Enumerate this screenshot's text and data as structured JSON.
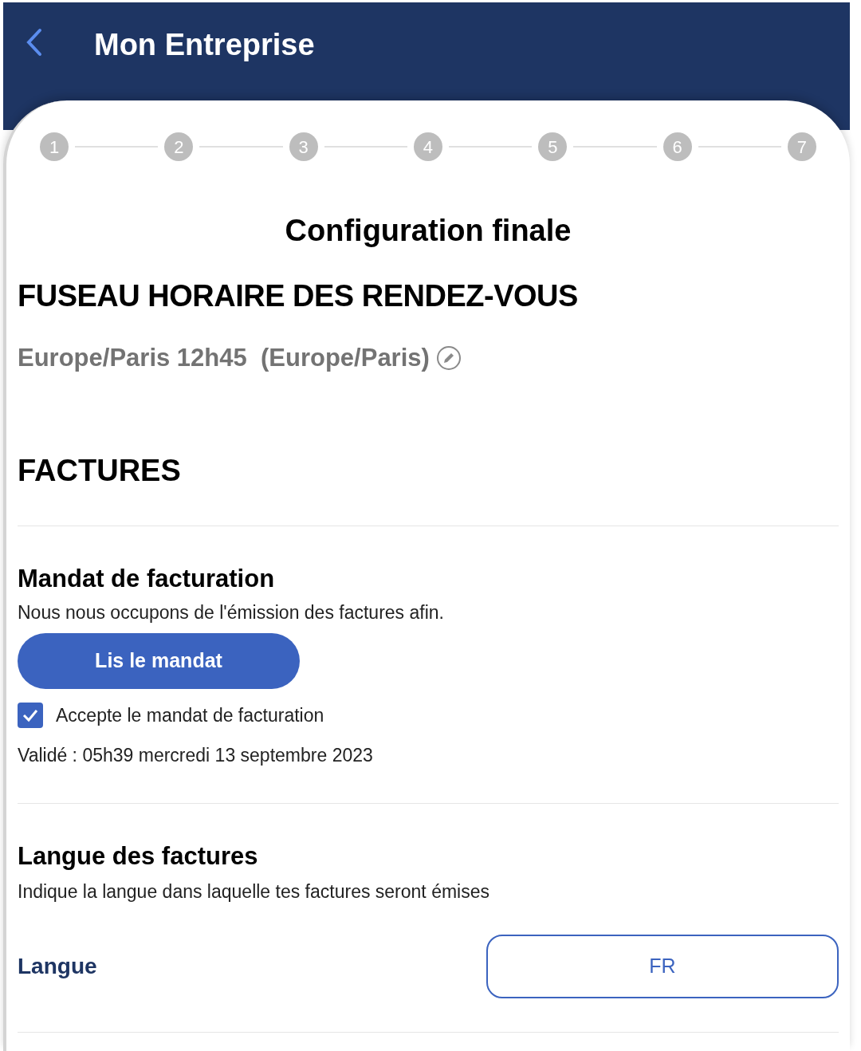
{
  "header": {
    "title": "Mon Entreprise"
  },
  "steps": [
    "1",
    "2",
    "3",
    "4",
    "5",
    "6",
    "7"
  ],
  "page_title": "Configuration finale",
  "timezone": {
    "heading": "FUSEAU HORAIRE DES RENDEZ-VOUS",
    "value": "Europe/Paris 12h45  (Europe/Paris)"
  },
  "invoices": {
    "heading": "FACTURES",
    "mandate": {
      "title": "Mandat de facturation",
      "description": "Nous nous occupons de l'émission des factures afin.",
      "button": "Lis le mandat",
      "accept": {
        "label": "Accepte le mandat de facturation",
        "checked": true
      },
      "validated": "Validé : 05h39 mercredi 13 septembre 2023"
    },
    "language": {
      "title": "Langue des factures",
      "description": "Indique la langue dans laquelle tes factures seront émises",
      "label": "Langue",
      "value": "FR"
    }
  }
}
